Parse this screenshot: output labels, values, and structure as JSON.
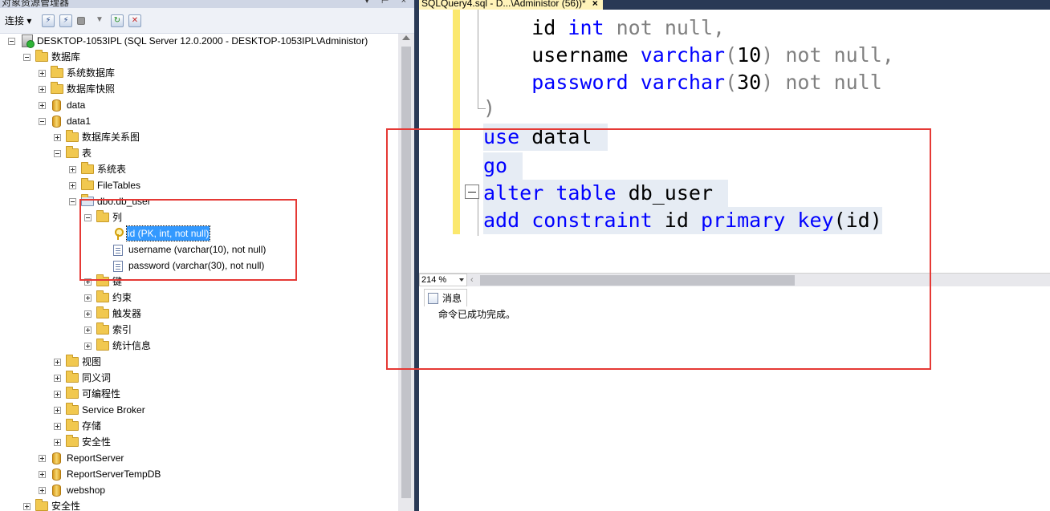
{
  "object_explorer": {
    "title": "对象资源管理器",
    "pin_icons": "▾ ⊢ ×",
    "toolbar": {
      "connect_label": "连接 ▾"
    },
    "tree": {
      "server": "DESKTOP-1053IPL (SQL Server 12.0.2000 - DESKTOP-1053IPL\\Administor)",
      "databases": "数据库",
      "system_databases": "系统数据库",
      "db_snapshots": "数据库快照",
      "db_data": "data",
      "db_data1": "data1",
      "diagrams": "数据库关系图",
      "tables": "表",
      "system_tables": "系统表",
      "file_tables": "FileTables",
      "table_db_user": "dbo.db_user",
      "columns": "列",
      "col_id": "id (PK, int, not null)",
      "col_username": "username (varchar(10), not null)",
      "col_password": "password (varchar(30), not null)",
      "keys": "键",
      "constraints": "约束",
      "triggers": "触发器",
      "indexes": "索引",
      "statistics": "统计信息",
      "views": "视图",
      "synonyms": "同义词",
      "programmability": "可编程性",
      "service_broker": "Service Broker",
      "storage": "存储",
      "security_db": "安全性",
      "report_server": "ReportServer",
      "report_server_temp": "ReportServerTempDB",
      "webshop": "webshop",
      "security_server": "安全性"
    }
  },
  "editor": {
    "tab_title": "SQLQuery4.sql - D...\\Administor (56))*",
    "tab_close": "×",
    "code": {
      "l1_name": "id",
      "l1_type": "int",
      "l1_rest": "not null,",
      "l2_name": "username",
      "l2_type": "varchar",
      "l2_open": "(",
      "l2_num": "10",
      "l2_close": ")",
      "l2_rest": "not null,",
      "l3_name": "password",
      "l3_type": "varchar",
      "l3_open": "(",
      "l3_num": "30",
      "l3_close": ")",
      "l3_rest": "not null",
      "l4": ")",
      "l5_kw": "use",
      "l5_name": "datal",
      "l6_kw": "go",
      "l7_kw1": "alter",
      "l7_kw2": "table",
      "l7_name": "db_user",
      "l8_kw1": "add",
      "l8_kw2": "constraint",
      "l8_name": "id",
      "l8_kw3": "primary",
      "l8_kw4": "key",
      "l8_args": "(id)"
    },
    "zoom": "214 %",
    "scroll_left": "‹"
  },
  "results": {
    "tab_label": "消息",
    "message": "命令已成功完成。"
  },
  "colors": {
    "selection": "#3399ff",
    "keyword": "#0000ff",
    "annotation": "#e53935",
    "change_bar": "#fbe86e"
  }
}
